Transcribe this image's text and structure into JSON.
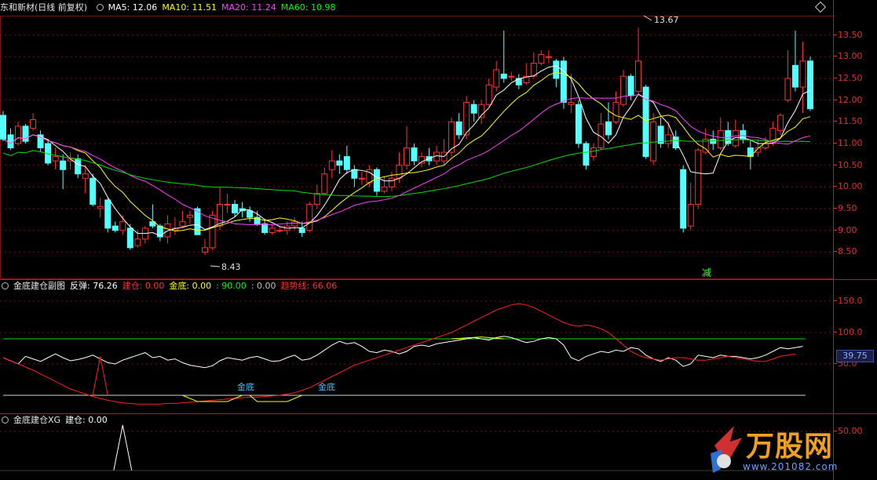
{
  "main_panel": {
    "stock_name": "东和新材",
    "period": "(日线 前复权)",
    "ma": [
      {
        "label": "MA5: 12.06",
        "color": "#ffffff"
      },
      {
        "label": "MA10: 11.51",
        "color": "#ffff00"
      },
      {
        "label": "MA20: 11.24",
        "color": "#ff40ff"
      },
      {
        "label": "MA60: 10.98",
        "color": "#00ff00"
      }
    ],
    "high_label": "13.67",
    "low_label": "8.43",
    "marker_label": "减"
  },
  "sub_panel1": {
    "title": "金底建仓副图",
    "items": [
      {
        "label": "反弹: 76.26",
        "color": "#ffffff"
      },
      {
        "label": "建仓: 0.00",
        "color": "#ff3030"
      },
      {
        "label": "金底: 0.00",
        "color": "#ffff00"
      },
      {
        "label": ": 90.00",
        "color": "#00ff00"
      },
      {
        "label": ": 0.00",
        "color": "#c0c0c0"
      },
      {
        "label": "趋势线: 66.06",
        "color": "#ff3030"
      }
    ],
    "gold_labels": [
      "金底",
      "金底"
    ],
    "current_value": "39.75"
  },
  "sub_panel2": {
    "title": "金底建仓XG",
    "items": [
      {
        "label": "建仓: 0.00",
        "color": "#ffffff"
      }
    ]
  },
  "axis": {
    "main_ticks": [
      "13.50",
      "13.00",
      "12.50",
      "12.00",
      "11.50",
      "11.00",
      "10.50",
      "10.00",
      "9.50",
      "9.00",
      "8.50"
    ],
    "sub1_ticks": [
      "150.0",
      "100.0",
      "50.0"
    ],
    "sub2_ticks": [
      "50.00"
    ]
  },
  "logo": {
    "word": "万股网",
    "url": "www.201082.com"
  },
  "chart_data": {
    "type": "candlestick",
    "price_range": [
      8.2,
      13.8
    ],
    "candles": [
      [
        11.65,
        11.1,
        11.75,
        11.05
      ],
      [
        11.2,
        10.9,
        11.35,
        10.85
      ],
      [
        11.0,
        11.4,
        11.5,
        10.95
      ],
      [
        11.4,
        11.05,
        11.45,
        11.0
      ],
      [
        11.35,
        11.55,
        11.7,
        11.3
      ],
      [
        11.2,
        10.9,
        11.3,
        10.8
      ],
      [
        11.0,
        10.55,
        11.1,
        10.5
      ],
      [
        10.6,
        10.7,
        10.9,
        10.4
      ],
      [
        10.6,
        10.4,
        10.75,
        9.95
      ],
      [
        10.6,
        10.65,
        10.8,
        10.4
      ],
      [
        10.65,
        10.3,
        10.75,
        10.2
      ],
      [
        10.2,
        10.3,
        10.5,
        9.85
      ],
      [
        10.2,
        9.6,
        10.3,
        9.55
      ],
      [
        9.5,
        9.55,
        9.75,
        9.3
      ],
      [
        9.7,
        9.05,
        9.75,
        8.95
      ],
      [
        9.1,
        9.0,
        9.2,
        8.95
      ],
      [
        9.0,
        9.2,
        9.35,
        8.9
      ],
      [
        9.05,
        8.6,
        9.15,
        8.55
      ],
      [
        8.65,
        8.8,
        9.0,
        8.6
      ],
      [
        8.8,
        9.05,
        9.1,
        8.7
      ],
      [
        9.2,
        9.1,
        9.6,
        9.05
      ],
      [
        9.1,
        8.85,
        9.15,
        8.75
      ],
      [
        8.85,
        9.15,
        9.35,
        8.7
      ],
      [
        9.0,
        9.05,
        9.3,
        8.9
      ],
      [
        9.1,
        9.2,
        9.45,
        9.05
      ],
      [
        9.3,
        9.35,
        9.45,
        9.15
      ],
      [
        9.5,
        8.9,
        9.55,
        8.9
      ],
      [
        8.5,
        8.6,
        8.8,
        8.43
      ],
      [
        8.6,
        9.35,
        9.45,
        8.55
      ],
      [
        9.1,
        9.6,
        10.0,
        9.0
      ],
      [
        9.6,
        9.6,
        9.85,
        9.4
      ],
      [
        9.6,
        9.4,
        9.7,
        9.3
      ],
      [
        9.5,
        9.45,
        9.65,
        9.3
      ],
      [
        9.45,
        9.3,
        9.55,
        9.2
      ],
      [
        9.3,
        9.15,
        9.45,
        9.1
      ],
      [
        9.15,
        8.95,
        9.25,
        8.9
      ],
      [
        8.95,
        9.05,
        9.15,
        8.9
      ],
      [
        9.0,
        9.0,
        9.1,
        8.95
      ],
      [
        9.0,
        9.1,
        9.2,
        8.9
      ],
      [
        9.1,
        9.2,
        9.3,
        9.0
      ],
      [
        9.05,
        8.95,
        9.2,
        8.85
      ],
      [
        9.0,
        9.6,
        9.65,
        8.95
      ],
      [
        9.6,
        9.85,
        10.05,
        9.5
      ],
      [
        9.85,
        10.3,
        10.45,
        9.8
      ],
      [
        10.4,
        10.6,
        10.85,
        10.2
      ],
      [
        10.6,
        10.5,
        10.75,
        10.3
      ],
      [
        10.7,
        10.4,
        10.95,
        10.3
      ],
      [
        10.4,
        10.2,
        10.5,
        10.0
      ],
      [
        10.2,
        10.2,
        10.35,
        10.05
      ],
      [
        10.1,
        10.4,
        10.5,
        10.0
      ],
      [
        10.4,
        9.9,
        10.45,
        9.8
      ],
      [
        9.9,
        10.0,
        10.25,
        9.85
      ],
      [
        10.0,
        10.2,
        10.35,
        9.9
      ],
      [
        10.2,
        10.5,
        10.8,
        10.1
      ],
      [
        10.5,
        10.9,
        11.4,
        10.4
      ],
      [
        10.9,
        10.6,
        11.0,
        10.5
      ],
      [
        10.55,
        10.7,
        10.8,
        10.45
      ],
      [
        10.7,
        10.6,
        10.9,
        10.5
      ],
      [
        10.6,
        10.8,
        10.95,
        10.5
      ],
      [
        10.6,
        10.8,
        11.1,
        10.5
      ],
      [
        10.8,
        11.5,
        11.6,
        10.7
      ],
      [
        11.5,
        11.2,
        11.7,
        11.1
      ],
      [
        11.2,
        11.95,
        12.1,
        11.1
      ],
      [
        11.9,
        11.7,
        12.0,
        11.5
      ],
      [
        11.6,
        11.9,
        12.0,
        11.45
      ],
      [
        11.9,
        12.35,
        12.5,
        11.85
      ],
      [
        12.3,
        12.7,
        12.9,
        12.2
      ],
      [
        12.6,
        12.5,
        13.6,
        12.4
      ],
      [
        12.55,
        12.55,
        12.65,
        12.45
      ],
      [
        12.5,
        12.35,
        12.6,
        12.25
      ],
      [
        12.4,
        12.55,
        12.85,
        12.35
      ],
      [
        12.55,
        12.85,
        13.1,
        12.5
      ],
      [
        12.85,
        13.05,
        13.15,
        12.8
      ],
      [
        13.0,
        13.0,
        13.15,
        12.85
      ],
      [
        12.9,
        12.5,
        12.95,
        12.3
      ],
      [
        12.9,
        11.95,
        13.0,
        11.8
      ],
      [
        11.9,
        11.95,
        12.6,
        11.7
      ],
      [
        11.9,
        11.0,
        12.0,
        10.9
      ],
      [
        11.0,
        10.5,
        11.05,
        10.4
      ],
      [
        10.7,
        10.9,
        11.0,
        10.6
      ],
      [
        10.9,
        11.45,
        11.7,
        10.85
      ],
      [
        11.5,
        11.2,
        11.95,
        11.1
      ],
      [
        11.5,
        11.95,
        12.2,
        11.45
      ],
      [
        11.9,
        12.55,
        12.7,
        11.85
      ],
      [
        12.55,
        12.1,
        12.6,
        12.0
      ],
      [
        12.2,
        12.9,
        13.67,
        12.15
      ],
      [
        12.3,
        10.7,
        12.35,
        10.65
      ],
      [
        10.6,
        11.5,
        11.7,
        10.5
      ],
      [
        11.4,
        11.0,
        11.6,
        10.9
      ],
      [
        11.0,
        11.2,
        11.5,
        10.9
      ],
      [
        11.15,
        10.9,
        11.3,
        10.85
      ],
      [
        10.4,
        9.05,
        10.5,
        8.95
      ],
      [
        9.1,
        9.6,
        10.1,
        9.0
      ],
      [
        9.6,
        10.85,
        10.9,
        9.5
      ],
      [
        10.8,
        11.1,
        11.35,
        10.75
      ],
      [
        11.1,
        11.0,
        11.3,
        10.85
      ],
      [
        10.9,
        11.3,
        11.6,
        10.85
      ],
      [
        11.3,
        11.0,
        11.5,
        10.95
      ],
      [
        10.95,
        11.3,
        11.55,
        10.9
      ],
      [
        11.3,
        11.1,
        11.45,
        11.0
      ],
      [
        10.9,
        10.7,
        11.1,
        10.4
      ],
      [
        10.8,
        10.9,
        11.1,
        10.7
      ],
      [
        10.9,
        11.0,
        11.15,
        10.85
      ],
      [
        11.0,
        11.35,
        11.5,
        10.95
      ],
      [
        11.3,
        11.65,
        11.7,
        11.2
      ],
      [
        12.0,
        12.5,
        13.15,
        11.95
      ],
      [
        12.8,
        12.3,
        13.6,
        12.2
      ],
      [
        12.3,
        12.9,
        13.35,
        11.7
      ],
      [
        12.9,
        11.8,
        13.0,
        11.75
      ]
    ]
  }
}
